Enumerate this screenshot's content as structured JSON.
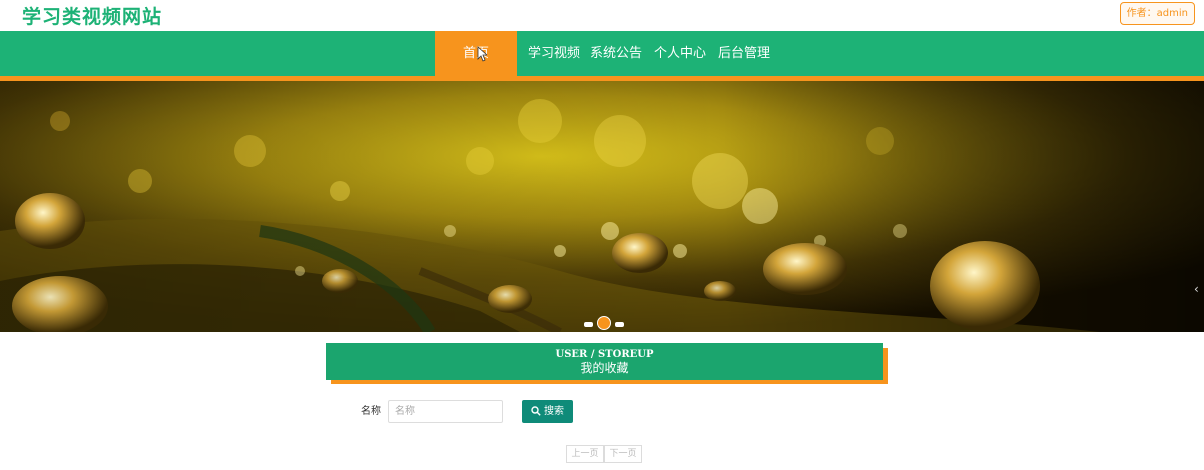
{
  "header": {
    "site_title": "学习类视频网站",
    "author_label": "作者：admin"
  },
  "nav": {
    "items": [
      {
        "label": "首页",
        "active": true
      },
      {
        "label": "学习视频"
      },
      {
        "label": "系统公告"
      },
      {
        "label": "个人中心"
      },
      {
        "label": "后台管理"
      }
    ]
  },
  "banner": {
    "slides": 3,
    "active_slide": 2,
    "next_icon": "chevron-left-icon"
  },
  "section": {
    "title_en": "USER / STOREUP",
    "title_zh": "我的收藏"
  },
  "search": {
    "label": "名称",
    "placeholder": "名称",
    "value": "",
    "button_label": "搜索",
    "button_icon": "search-icon"
  },
  "pagination": {
    "prev_label": "上一页",
    "next_label": "下一页"
  },
  "colors": {
    "primary": "#1db276",
    "accent": "#f7941d",
    "search_button": "#0f8b79"
  }
}
